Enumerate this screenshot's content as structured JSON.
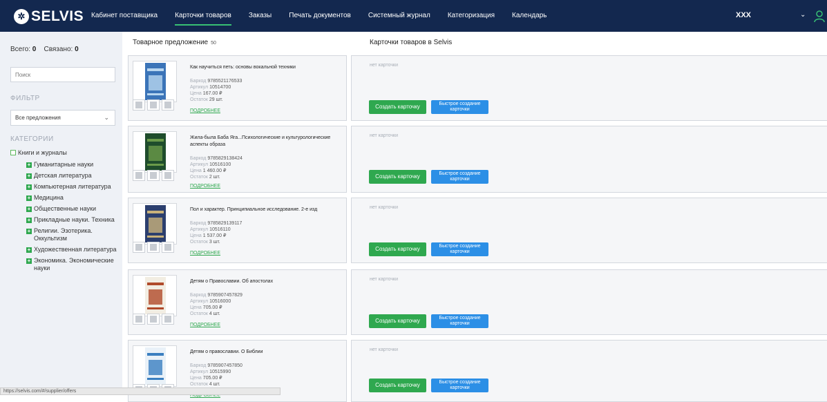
{
  "header": {
    "logo_text": "SELVIS",
    "nav": [
      {
        "label": "Кабинет поставщика",
        "active": false
      },
      {
        "label": "Карточки товаров",
        "active": true
      },
      {
        "label": "Заказы",
        "active": false
      },
      {
        "label": "Печать документов",
        "active": false
      },
      {
        "label": "Системный журнал",
        "active": false
      },
      {
        "label": "Категоризация",
        "active": false
      },
      {
        "label": "Календарь",
        "active": false
      }
    ],
    "user_name": "XXX",
    "accent_color": "#38c174",
    "bar_color": "#13284f"
  },
  "sidebar": {
    "total_label": "Всего:",
    "total_value": "0",
    "linked_label": "Связано:",
    "linked_value": "0",
    "search_placeholder": "Поиск",
    "filter_title": "ФИЛЬТР",
    "filter_value": "Все предложения",
    "categories_title": "КАТЕГОРИИ",
    "root_category": "Книги и журналы",
    "categories": [
      "Гуманитарные науки",
      "Детская литература",
      "Компьютерная литература",
      "Медицина",
      "Общественные науки",
      "Прикладные науки. Техника",
      "Религии. Эзотерика. Оккультизм",
      "Художественная литература",
      "Экономика. Экономические науки"
    ]
  },
  "status_url": "https://selvis.com/#/supplier/offers",
  "offers": {
    "title": "Товарное предложение",
    "count": "50",
    "labels": {
      "barcode": "Баркод",
      "article": "Артикул",
      "price": "Цена",
      "stock": "Остаток",
      "more": "ПОДРОБНЕЕ"
    },
    "items": [
      {
        "title": "Как научиться петь: основы вокальной техники",
        "barcode": "9785521176533",
        "article": "10514700",
        "price": "167.00 ₽",
        "stock": "29 шт."
      },
      {
        "title": "Жила-была Баба Яга...Психологические и культурологические аспекты образа",
        "barcode": "9785829138424",
        "article": "10516100",
        "price": "1 460.00 ₽",
        "stock": "2 шт."
      },
      {
        "title": "Пол и характер. Принципиальное исследование. 2-е изд",
        "barcode": "9785829139117",
        "article": "10516110",
        "price": "1 537.00 ₽",
        "stock": "3 шт."
      },
      {
        "title": "Детям о Православии. Об апостолах",
        "barcode": "9785907457829",
        "article": "10516000",
        "price": "705.00 ₽",
        "stock": "4 шт."
      },
      {
        "title": "Детям о православии. О Библии",
        "barcode": "9785907457850",
        "article": "10515990",
        "price": "705.00 ₽",
        "stock": "4 шт."
      }
    ]
  },
  "cards": {
    "title": "Карточки товаров в Selvis",
    "no_card": "нет карточки",
    "create_label": "Создать карточку",
    "fast_create_line1": "Быстрое создание",
    "fast_create_line2": "карточки",
    "create_color": "#2fa84f",
    "fast_color": "#2c8fe6"
  }
}
